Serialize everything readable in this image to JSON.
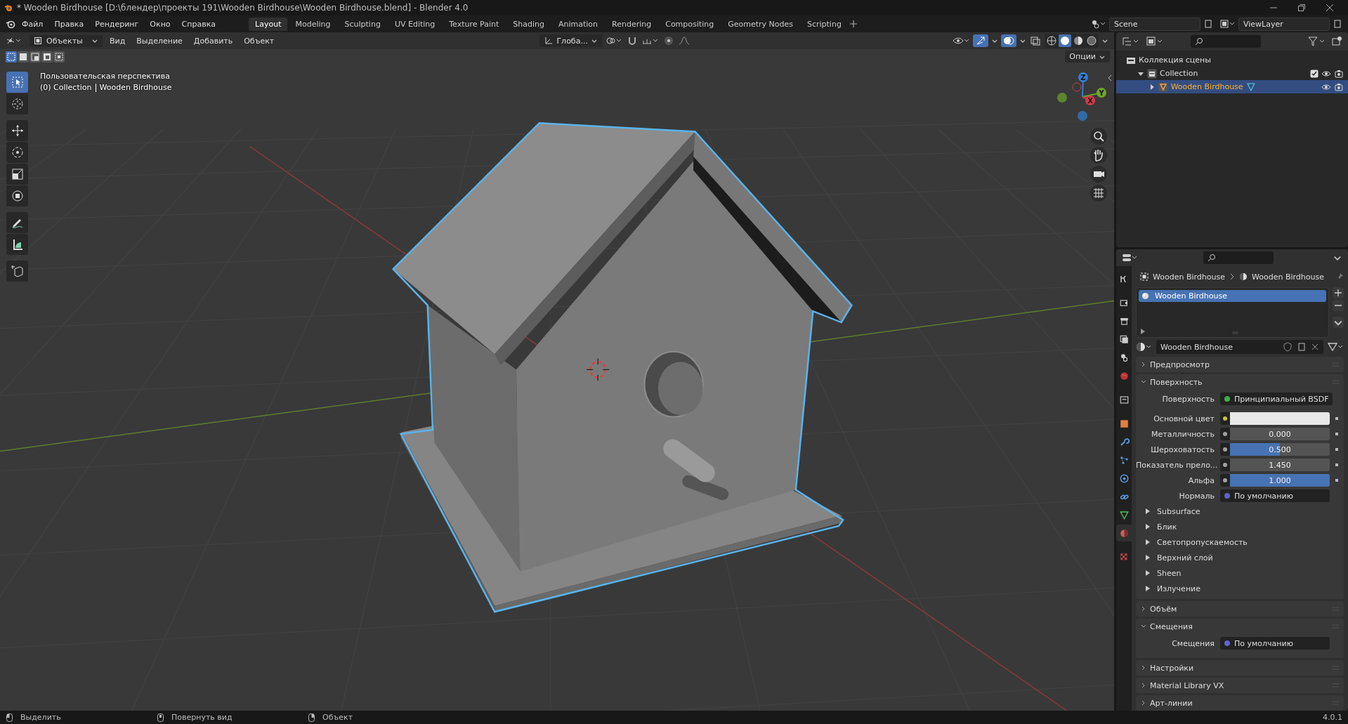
{
  "window": {
    "title": "* Wooden Birdhouse [D:\\блендер\\проекты 191\\Wooden Birdhouse\\Wooden Birdhouse.blend] - Blender 4.0"
  },
  "menu": [
    "Файл",
    "Правка",
    "Рендеринг",
    "Окно",
    "Справка"
  ],
  "workspaces": [
    {
      "label": "Layout",
      "selected": true
    },
    {
      "label": "Modeling",
      "selected": false
    },
    {
      "label": "Sculpting",
      "selected": false
    },
    {
      "label": "UV Editing",
      "selected": false
    },
    {
      "label": "Texture Paint",
      "selected": false
    },
    {
      "label": "Shading",
      "selected": false
    },
    {
      "label": "Animation",
      "selected": false
    },
    {
      "label": "Rendering",
      "selected": false
    },
    {
      "label": "Compositing",
      "selected": false
    },
    {
      "label": "Geometry Nodes",
      "selected": false
    },
    {
      "label": "Scripting",
      "selected": false
    }
  ],
  "scene": {
    "name": "Scene"
  },
  "view_layer": {
    "name": "ViewLayer"
  },
  "viewport": {
    "mode": "Объекты",
    "menus": [
      "Вид",
      "Выделение",
      "Добавить",
      "Объект"
    ],
    "orientation": "Глоба...",
    "options": "Опции",
    "view_name": "Пользовательская перспектива",
    "collection": "(0) Collection",
    "object": "Wooden Birdhouse",
    "axes": [
      "Z",
      "Y",
      "X"
    ]
  },
  "select_modes": [
    {
      "selected": true
    },
    {
      "selected": false
    },
    {
      "selected": false
    },
    {
      "selected": false
    },
    {
      "selected": false
    }
  ],
  "shading_modes": [
    {
      "selected": false
    },
    {
      "selected": true
    },
    {
      "selected": false
    },
    {
      "selected": false
    }
  ],
  "tools": [
    {
      "selected": true
    },
    {
      "selected": false
    },
    {
      "selected": false
    },
    {
      "selected": false
    },
    {
      "selected": false
    },
    {
      "selected": false
    },
    {
      "selected": false
    },
    {
      "selected": false
    },
    {
      "selected": false
    }
  ],
  "outliner": {
    "items": [
      {
        "label": "Коллекция сцены",
        "selected": false,
        "children": [
          {
            "label": "Collection",
            "selected": false,
            "expanded": true,
            "checked": true,
            "children": [
              {
                "label": "Wooden Birdhouse",
                "selected": true,
                "expanded": false
              }
            ]
          }
        ]
      }
    ]
  },
  "property_tabs": [
    {
      "kind": "tool",
      "selected": false
    },
    {
      "kind": "render",
      "selected": false
    },
    {
      "kind": "output",
      "selected": false
    },
    {
      "kind": "view-layer",
      "selected": false
    },
    {
      "kind": "scene",
      "selected": false
    },
    {
      "kind": "world",
      "selected": false
    },
    {
      "kind": "collection",
      "selected": false
    },
    {
      "kind": "object",
      "selected": false
    },
    {
      "kind": "modifier",
      "selected": false
    },
    {
      "kind": "particles",
      "selected": false
    },
    {
      "kind": "physics",
      "selected": false
    },
    {
      "kind": "constraint",
      "selected": false
    },
    {
      "kind": "data",
      "selected": false
    },
    {
      "kind": "material",
      "selected": true
    },
    {
      "kind": "texture",
      "selected": false
    }
  ],
  "properties": {
    "breadcrumb": [
      "Wooden Birdhouse",
      "Wooden Birdhouse"
    ],
    "slots": [
      {
        "label": "Wooden Birdhouse",
        "selected": true
      }
    ],
    "material": "Wooden Birdhouse",
    "panels": [
      {
        "title": "Предпросмотр",
        "expanded": false
      },
      {
        "title": "Поверхность",
        "expanded": true,
        "rows": [
          {
            "kind": "link",
            "label": "Поверхность",
            "value": "Принципиальный BSDF",
            "color": "#3fae4a"
          },
          {
            "kind": "color",
            "label": "Основной цвет",
            "color": "#c7c72e"
          },
          {
            "kind": "slider",
            "label": "Металличность",
            "value": "0.000",
            "level": 0,
            "color": "#a1a1a1"
          },
          {
            "kind": "slider",
            "label": "Шероховатость",
            "value": "0.500",
            "level": 0.5,
            "color": "#a1a1a1"
          },
          {
            "kind": "number",
            "label": "Показатель прело...",
            "value": "1.450",
            "color": "#a1a1a1"
          },
          {
            "kind": "slider",
            "label": "Альфа",
            "value": "1.000",
            "level": 1,
            "color": "#a1a1a1"
          },
          {
            "kind": "link",
            "label": "Нормаль",
            "value": "По умолчанию",
            "color": "#6363c7"
          },
          {
            "kind": "subpanel",
            "label": "Subsurface",
            "expanded": false
          },
          {
            "kind": "subpanel",
            "label": "Блик",
            "expanded": false
          },
          {
            "kind": "subpanel",
            "label": "Светопропускаемость",
            "expanded": false
          },
          {
            "kind": "subpanel",
            "label": "Верхний слой",
            "expanded": false
          },
          {
            "kind": "subpanel",
            "label": "Sheen",
            "expanded": false
          },
          {
            "kind": "subpanel",
            "label": "Излучение",
            "expanded": false
          }
        ]
      },
      {
        "title": "Объём",
        "expanded": false
      },
      {
        "title": "Смещения",
        "expanded": true,
        "rows": [
          {
            "kind": "link",
            "label": "Смещения",
            "value": "По умолчанию",
            "color": "#6363c7"
          }
        ]
      },
      {
        "title": "Настройки",
        "expanded": false
      },
      {
        "title": "Material Library VX",
        "expanded": false
      },
      {
        "title": "Арт-линии",
        "expanded": false
      }
    ]
  },
  "status_bar": {
    "hints": [
      "Выделить",
      "Повернуть вид",
      "Объект"
    ],
    "version": "4.0.1"
  }
}
